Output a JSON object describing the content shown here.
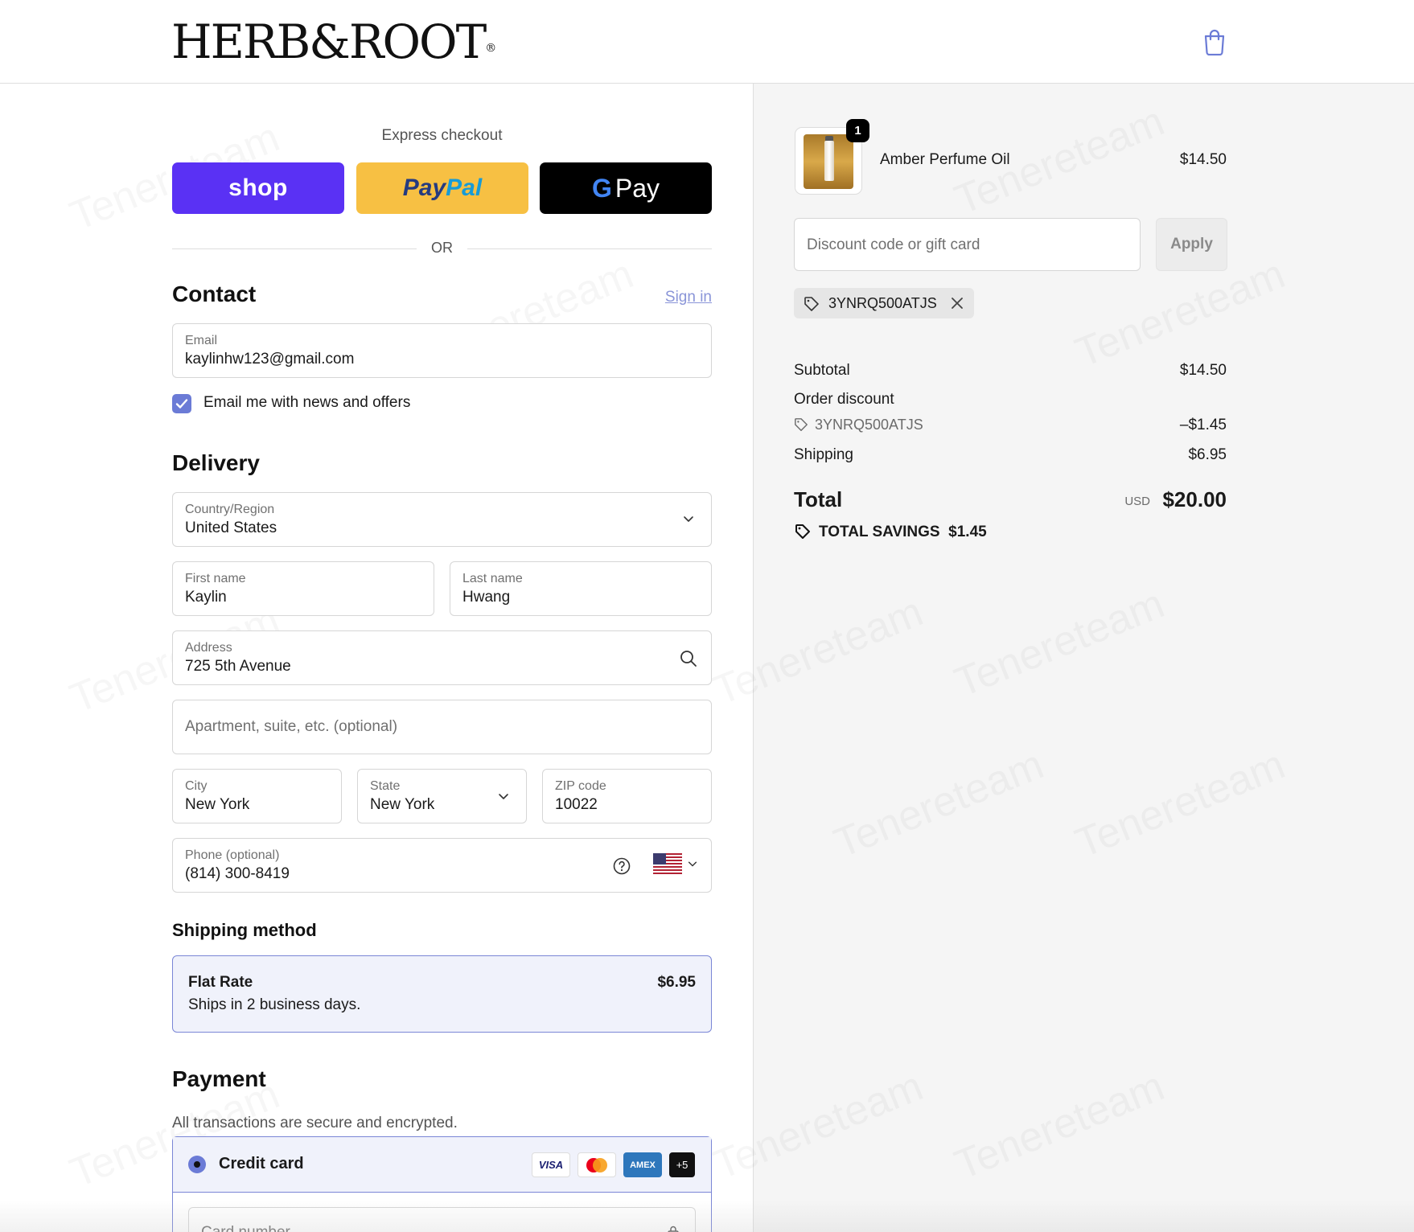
{
  "header": {
    "logo_text": "HERB&ROOT",
    "logo_mark": "®",
    "cart_icon": "shopping-bag-icon"
  },
  "express": {
    "title": "Express checkout",
    "shop_label": "shop",
    "paypal_label_1": "Pay",
    "paypal_label_2": "Pal",
    "gpay_g": "G",
    "gpay_label": "Pay",
    "or_label": "OR"
  },
  "contact": {
    "title": "Contact",
    "sign_in": "Sign in",
    "email_label": "Email",
    "email_value": "kaylinhw123@gmail.com",
    "news_label": "Email me with news and offers",
    "news_checked": true
  },
  "delivery": {
    "title": "Delivery",
    "country_label": "Country/Region",
    "country_value": "United States",
    "first_label": "First name",
    "first_value": "Kaylin",
    "last_label": "Last name",
    "last_value": "Hwang",
    "address_label": "Address",
    "address_value": "725 5th Avenue",
    "apt_placeholder": "Apartment, suite, etc. (optional)",
    "city_label": "City",
    "city_value": "New York",
    "state_label": "State",
    "state_value": "New York",
    "zip_label": "ZIP code",
    "zip_value": "10022",
    "phone_label": "Phone (optional)",
    "phone_value": "(814) 300-8419"
  },
  "shipping": {
    "title": "Shipping method",
    "name": "Flat Rate",
    "desc": "Ships in 2 business days.",
    "price": "$6.95"
  },
  "payment": {
    "title": "Payment",
    "subtitle": "All transactions are secure and encrypted.",
    "method": "Credit card",
    "cards": [
      "VISA",
      "AMEX",
      "+5"
    ],
    "card_number_placeholder": "Card number"
  },
  "summary": {
    "qty": "1",
    "product_name": "Amber Perfume Oil",
    "product_price": "$14.50",
    "discount_placeholder": "Discount code or gift card",
    "apply_label": "Apply",
    "applied_code": "3YNRQ500ATJS",
    "subtotal_label": "Subtotal",
    "subtotal_value": "$14.50",
    "order_discount_label": "Order discount",
    "discount_code": "3YNRQ500ATJS",
    "discount_value": "–$1.45",
    "shipping_label": "Shipping",
    "shipping_value": "$6.95",
    "total_label": "Total",
    "currency": "USD",
    "total_value": "$20.00",
    "savings_label": "TOTAL SAVINGS",
    "savings_value": "$1.45"
  },
  "watermark": "Tenereteam",
  "colors": {
    "shop": "#5a31f4",
    "paypal": "#f7c043",
    "gpay": "#000000",
    "accent": "#6b7bd6",
    "link": "#8a95d8",
    "panel_bg": "#f5f5f5"
  }
}
